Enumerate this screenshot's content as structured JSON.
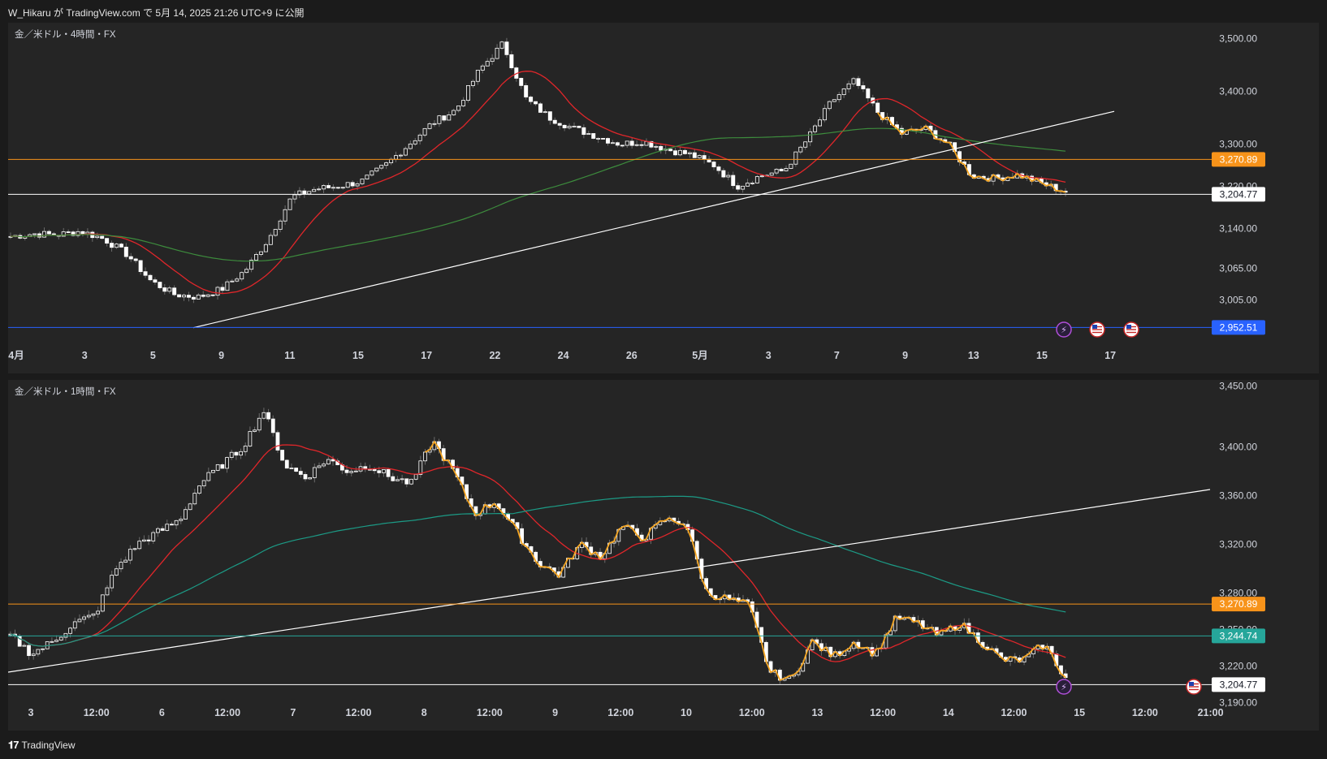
{
  "header": {
    "title": "W_Hikaru が TradingView.com で 5月 14, 2025 21:26 UTC+9 に公開"
  },
  "footer": {
    "brand": "TradingView",
    "logo_icon": "tradingview-logo-icon"
  },
  "colors": {
    "background": "#1b1b1b",
    "pane": "#252525",
    "candle": "#ffffff",
    "wick": "#6b6b6b",
    "ma_fast": "#e0262a",
    "ma_slow_top": "#3d8c3d",
    "ma_slow_bottom": "#1c9b86",
    "zigzag": "#f5a623",
    "orange_line": "#f7931a",
    "blue_line": "#2962ff",
    "teal_tag": "#26a69a",
    "white_line": "#ffffff"
  },
  "panes": [
    {
      "id": "top",
      "label": "金／米ドル・4時間・FX",
      "y_ticks": [
        "3,500.00",
        "3,400.00",
        "3,300.00",
        "3,220.00",
        "3,140.00",
        "3,065.00",
        "3,005.00"
      ],
      "x_ticks": [
        "4月",
        "3",
        "5",
        "9",
        "11",
        "15",
        "17",
        "22",
        "24",
        "26",
        "5月",
        "3",
        "7",
        "9",
        "13",
        "15",
        "17"
      ],
      "price_tags": [
        {
          "label": "3,270.89",
          "value": 3270.89,
          "style": "orange"
        },
        {
          "label": "3,204.77",
          "value": 3204.77,
          "style": "white"
        },
        {
          "label": "2,952.51",
          "value": 2952.51,
          "style": "blue"
        }
      ],
      "event_icons": [
        "lightning-icon",
        "us-flag-icon",
        "us-flag-icon"
      ]
    },
    {
      "id": "bottom",
      "label": "金／米ドル・1時間・FX",
      "y_ticks": [
        "3,450.00",
        "3,400.00",
        "3,360.00",
        "3,320.00",
        "3,280.00",
        "3,250.00",
        "3,220.00",
        "3,190.00"
      ],
      "x_ticks": [
        "3",
        "12:00",
        "6",
        "12:00",
        "7",
        "12:00",
        "8",
        "12:00",
        "9",
        "12:00",
        "10",
        "12:00",
        "13",
        "12:00",
        "14",
        "12:00",
        "15",
        "12:00",
        "21:00"
      ],
      "price_tags": [
        {
          "label": "3,270.89",
          "value": 3270.89,
          "style": "orange"
        },
        {
          "label": "3,244.74",
          "value": 3244.74,
          "style": "teal"
        },
        {
          "label": "3,204.77",
          "value": 3204.77,
          "style": "white"
        }
      ],
      "event_icons": [
        "lightning-icon",
        "us-flag-icon"
      ]
    }
  ],
  "chart_data": [
    {
      "type": "candlestick",
      "title": "金／米ドル・4時間・FX",
      "ylim": [
        2930,
        3530
      ],
      "x_categories": [
        "4月",
        "3",
        "5",
        "9",
        "11",
        "15",
        "17",
        "22",
        "24",
        "26",
        "5月",
        "3",
        "7",
        "9",
        "13",
        "15",
        "17"
      ],
      "close_path_approx": [
        3125,
        3130,
        3128,
        3135,
        3120,
        3090,
        3040,
        3015,
        3010,
        3025,
        3060,
        3120,
        3200,
        3215,
        3220,
        3230,
        3260,
        3300,
        3340,
        3365,
        3440,
        3490,
        3385,
        3350,
        3330,
        3315,
        3300,
        3305,
        3290,
        3280,
        3260,
        3220,
        3240,
        3250,
        3310,
        3380,
        3420,
        3360,
        3320,
        3330,
        3300,
        3240,
        3235,
        3242,
        3225,
        3210
      ],
      "horizontal_levels": [
        3270.89,
        3204.77,
        2952.51
      ],
      "series": [
        {
          "name": "",
          "kind": "moving-average-fast",
          "color": "#e0262a"
        },
        {
          "name": "",
          "kind": "moving-average-slow",
          "color": "#3d8c3d"
        },
        {
          "name": "",
          "kind": "trendline",
          "color": "#ffffff"
        },
        {
          "name": "",
          "kind": "zigzag",
          "color": "#f5a623"
        }
      ]
    },
    {
      "type": "candlestick",
      "title": "金／米ドル・1時間・FX",
      "ylim": [
        3195,
        3455
      ],
      "x_categories": [
        "3",
        "12:00",
        "6",
        "12:00",
        "7",
        "12:00",
        "8",
        "12:00",
        "9",
        "12:00",
        "10",
        "12:00",
        "13",
        "12:00",
        "14",
        "12:00",
        "15",
        "12:00",
        "21:00"
      ],
      "close_path_approx": [
        3245,
        3230,
        3240,
        3255,
        3262,
        3300,
        3320,
        3330,
        3340,
        3370,
        3385,
        3400,
        3430,
        3385,
        3375,
        3390,
        3380,
        3385,
        3375,
        3370,
        3405,
        3380,
        3345,
        3355,
        3330,
        3305,
        3295,
        3320,
        3310,
        3335,
        3325,
        3340,
        3338,
        3280,
        3275,
        3270,
        3215,
        3208,
        3240,
        3228,
        3240,
        3230,
        3260,
        3255,
        3245,
        3255,
        3240,
        3225,
        3225,
        3238,
        3210
      ],
      "horizontal_levels": [
        3270.89,
        3244.74,
        3204.77
      ],
      "series": [
        {
          "name": "",
          "kind": "moving-average-fast",
          "color": "#e0262a"
        },
        {
          "name": "",
          "kind": "moving-average-slow",
          "color": "#1c9b86"
        },
        {
          "name": "",
          "kind": "trendline",
          "color": "#ffffff"
        },
        {
          "name": "",
          "kind": "zigzag",
          "color": "#f5a623"
        }
      ]
    }
  ]
}
